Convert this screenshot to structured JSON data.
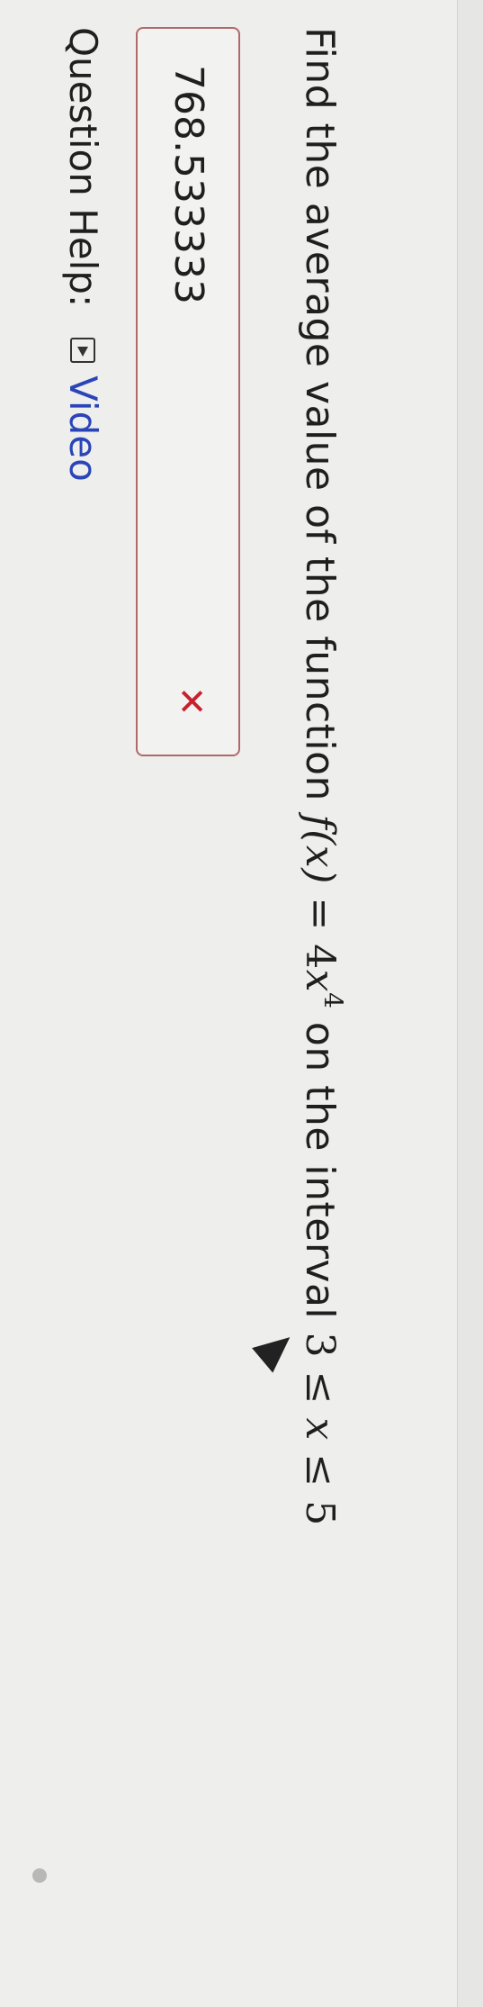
{
  "question": {
    "prefix": "Find the average value of the function",
    "func_name": "f",
    "func_var": "(x)",
    "equals": " = ",
    "coef": "4",
    "var": "x",
    "exponent": "4",
    "middle": "on the interval",
    "lower": "3",
    "leq1": "≤",
    "interval_var": "x",
    "leq2": "≤",
    "upper": "5"
  },
  "answer": {
    "value": "768.533333",
    "status_mark": "✕"
  },
  "help": {
    "label": "Question Help:",
    "video_label": "Video"
  },
  "icons": {
    "play": "play-icon",
    "cursor": "cursor-icon",
    "wrong": "x-mark-icon"
  },
  "colors": {
    "wrong": "#c8202c",
    "link": "#2a45b8",
    "box_border": "#b06a6a"
  }
}
